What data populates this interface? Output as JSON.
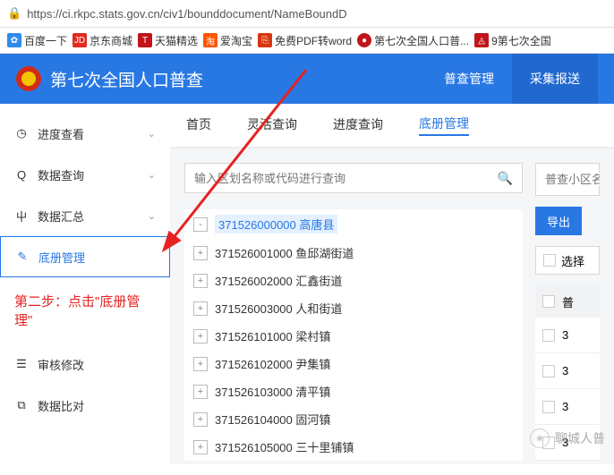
{
  "url": "https://ci.rkpc.stats.gov.cn/civ1/bounddocument/NameBoundD",
  "bookmarks": [
    {
      "label": "百度一下",
      "cls": "baidu",
      "glyph": "✿"
    },
    {
      "label": "京东商城",
      "cls": "jd",
      "glyph": "JD"
    },
    {
      "label": "天猫精选",
      "cls": "tmall",
      "glyph": "T"
    },
    {
      "label": "爱淘宝",
      "cls": "taobao",
      "glyph": "淘"
    },
    {
      "label": "免费PDF转word",
      "cls": "pdf",
      "glyph": "⎘"
    },
    {
      "label": "第七次全国人口普...",
      "cls": "census",
      "glyph": "●"
    },
    {
      "label": "9第七次全国",
      "cls": "nine",
      "glyph": "◬"
    }
  ],
  "header": {
    "title": "第七次全国人口普查",
    "tabs": [
      {
        "label": "普查管理"
      },
      {
        "label": "采集报送",
        "active": true
      }
    ]
  },
  "sidebar": [
    {
      "label": "进度查看",
      "icon": "◷",
      "chev": true
    },
    {
      "label": "数据查询",
      "icon": "Q",
      "chev": true
    },
    {
      "label": "数据汇总",
      "icon": "⼬",
      "chev": true
    },
    {
      "label": "底册管理",
      "icon": "✎",
      "active": true
    },
    {
      "label": "审核修改",
      "icon": "☰"
    },
    {
      "label": "数据比对",
      "icon": "⧉"
    }
  ],
  "annotation": "第二步：点击\"底册管理\"",
  "subtabs": [
    {
      "label": "首页"
    },
    {
      "label": "灵活查询"
    },
    {
      "label": "进度查询"
    },
    {
      "label": "底册管理",
      "active": true
    }
  ],
  "search": {
    "placeholder": "输入区划名称或代码进行查询",
    "placeholder2": "普查小区名"
  },
  "tree": [
    {
      "code": "371526000000",
      "name": "高唐县",
      "root": true,
      "open": true
    },
    {
      "code": "371526001000",
      "name": "鱼邱湖街道"
    },
    {
      "code": "371526002000",
      "name": "汇鑫街道"
    },
    {
      "code": "371526003000",
      "name": "人和街道"
    },
    {
      "code": "371526101000",
      "name": "梁村镇"
    },
    {
      "code": "371526102000",
      "name": "尹集镇"
    },
    {
      "code": "371526103000",
      "name": "清平镇"
    },
    {
      "code": "371526104000",
      "name": "固河镇"
    },
    {
      "code": "371526105000",
      "name": "三十里铺镇"
    }
  ],
  "buttons": {
    "export": "导出",
    "select_all": "选择"
  },
  "table": {
    "col1": "普",
    "rows": [
      "3",
      "3",
      "3",
      "3"
    ]
  },
  "watermark": "聊城人普"
}
